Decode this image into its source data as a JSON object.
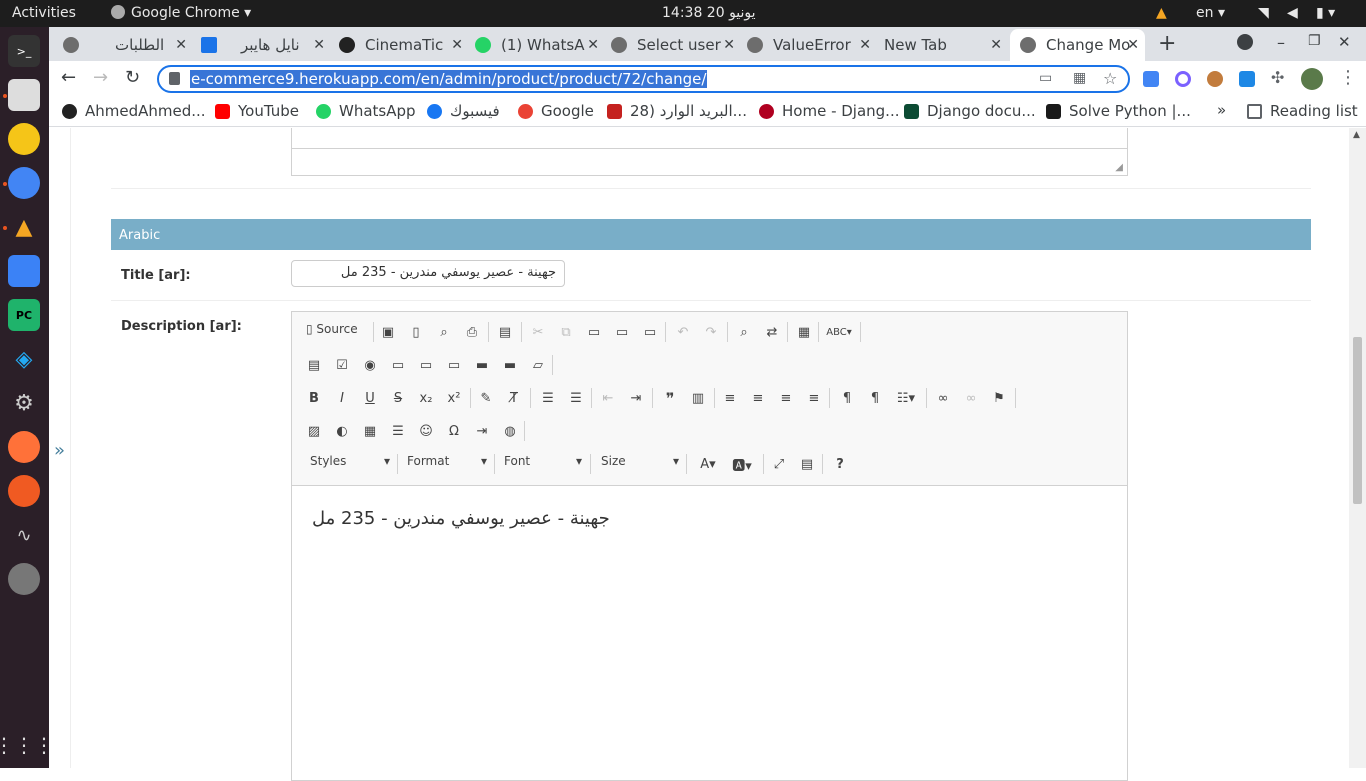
{
  "topbar": {
    "activities": "Activities",
    "app_name": "Google Chrome",
    "clock": "14:38  20 يونيو",
    "lang": "en"
  },
  "tabs": [
    {
      "label": "الطلبات"
    },
    {
      "label": "نايل هايبر"
    },
    {
      "label": "CinemaTic"
    },
    {
      "label": "(1) WhatsA"
    },
    {
      "label": "Select user"
    },
    {
      "label": "ValueError"
    },
    {
      "label": "New Tab"
    },
    {
      "label": "Change Mo"
    }
  ],
  "address": {
    "url": "e-commerce9.herokuapp.com/en/admin/product/product/72/change/"
  },
  "bookmarks": [
    {
      "label": "AhmedAhmed..."
    },
    {
      "label": "YouTube"
    },
    {
      "label": "WhatsApp"
    },
    {
      "label": "فيسبوك"
    },
    {
      "label": "Google"
    },
    {
      "label": "البريد الوارد (28..."
    },
    {
      "label": "Home - Djang..."
    },
    {
      "label": "Django docu..."
    },
    {
      "label": "Solve Python |..."
    }
  ],
  "reading_list": "Reading list",
  "form": {
    "section_title": "Arabic",
    "title_label": "Title [ar]:",
    "title_value": "جهينة - عصير يوسفي مندرين - 235 مل",
    "desc_label": "Description [ar]:",
    "source_label": "Source",
    "combos": [
      "Styles",
      "Format",
      "Font",
      "Size"
    ],
    "editor_text": "جهينة - عصير يوسفي مندرين - 235 مل"
  },
  "collapse_glyph": "»"
}
